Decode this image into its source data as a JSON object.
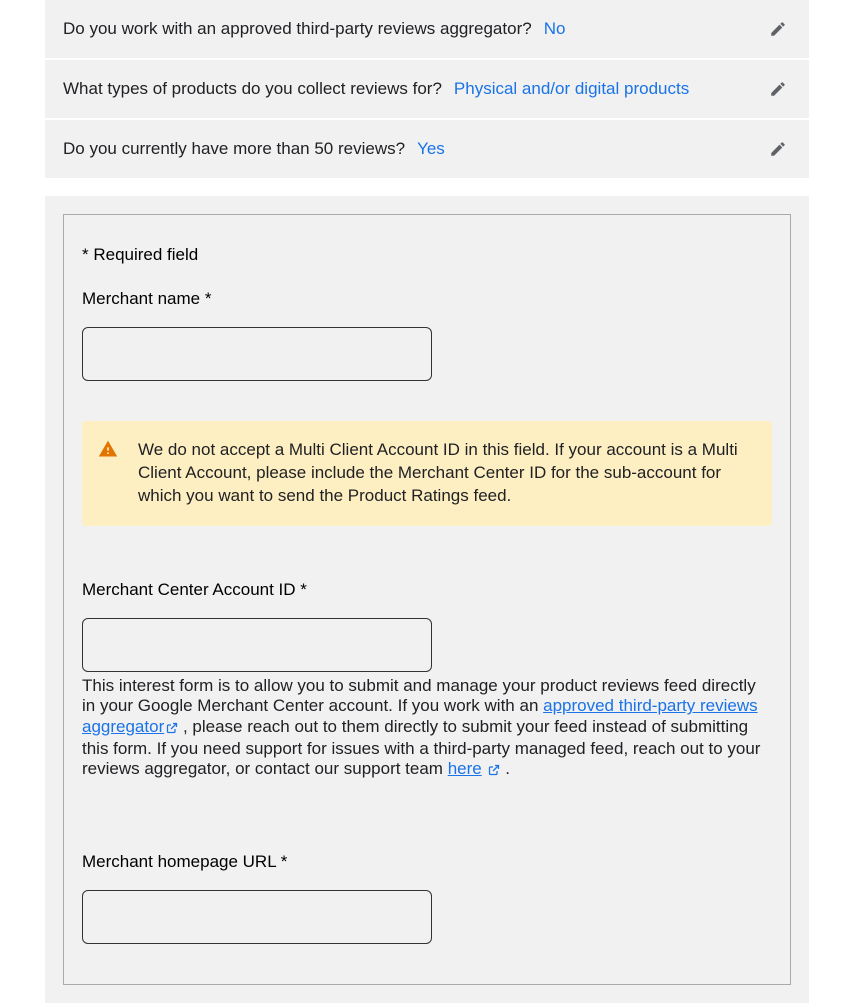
{
  "summaries": [
    {
      "question": "Do you work with an approved third-party reviews aggregator?",
      "answer": "No"
    },
    {
      "question": "What types of products do you collect reviews for?",
      "answer": "Physical and/or digital products"
    },
    {
      "question": "Do you currently have more than 50 reviews?",
      "answer": "Yes"
    }
  ],
  "form": {
    "required_note": "* Required field",
    "merchant_name_label": "Merchant name  *",
    "alert_text": "We do not accept a Multi Client Account ID in this field. If your account is a Multi Client Account, please include the Merchant Center ID for the sub-account for which you want to send the Product Ratings feed.",
    "account_id_label": "Merchant Center Account ID *",
    "help_intro": "This interest form is to allow you to submit and manage your product reviews feed directly in your Google Merchant Center account.  If you work with an ",
    "help_link1": "approved third-party reviews aggregator",
    "help_mid": " , please reach out to them directly to submit your feed instead of submitting this form. If you need support for issues with a third-party managed feed, reach out to your reviews aggregator, or contact our support team ",
    "help_link2": "here",
    "help_end": " .",
    "homepage_label": "Merchant homepage URL  *"
  }
}
